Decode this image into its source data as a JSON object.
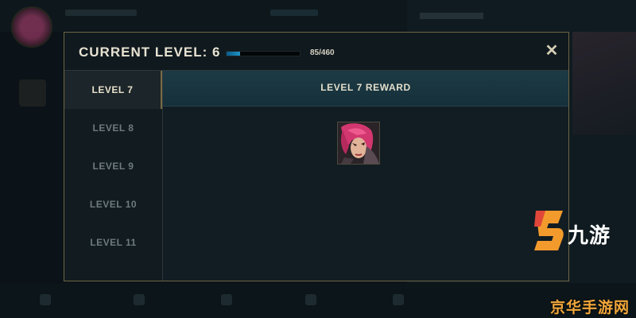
{
  "modal": {
    "title": "CURRENT LEVEL: 6",
    "xp": {
      "text": "85/460",
      "current": 85,
      "max": 460
    },
    "close_glyph": "✕"
  },
  "levels": [
    {
      "label": "LEVEL 7",
      "active": true
    },
    {
      "label": "LEVEL 8",
      "active": false
    },
    {
      "label": "LEVEL 9",
      "active": false
    },
    {
      "label": "LEVEL 10",
      "active": false
    },
    {
      "label": "LEVEL 11",
      "active": false
    }
  ],
  "reward": {
    "title": "LEVEL 7 REWARD",
    "icon": "champion-portrait-icon"
  },
  "watermark": {
    "brand": "九游",
    "site": "京华手游网"
  },
  "colors": {
    "accent_gold": "#6f6545",
    "xp_blue": "#1f93c4",
    "site_orange": "#f3a73a"
  }
}
